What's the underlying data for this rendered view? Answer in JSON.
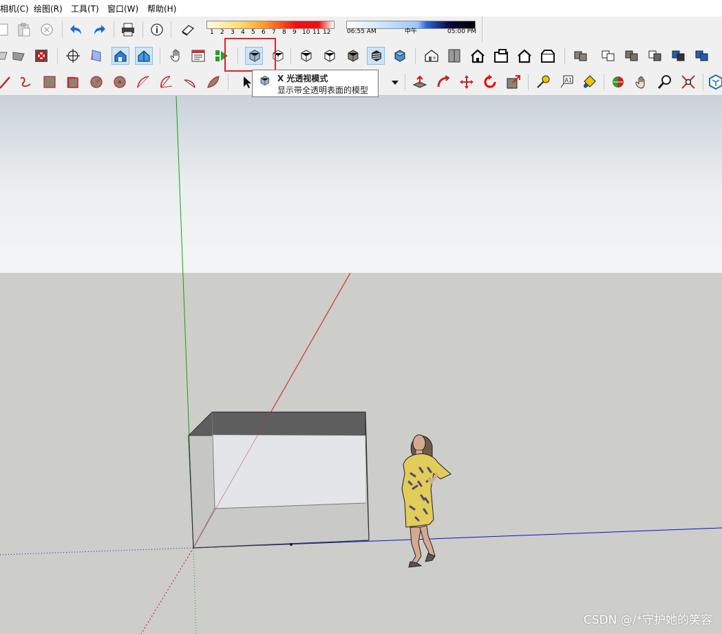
{
  "menu": {
    "items": [
      "相机(C)",
      "绘图(R)",
      "工具(T)",
      "窗口(W)",
      "帮助(H)"
    ]
  },
  "shadow_months": [
    "1",
    "2",
    "3",
    "4",
    "5",
    "6",
    "7",
    "8",
    "9",
    "10",
    "11",
    "12"
  ],
  "shadow_time": {
    "start": "06:55 AM",
    "noon": "中午",
    "end": "05:00 PM"
  },
  "tooltip": {
    "title": "X 光透视模式",
    "description": "显示带全透明表面的模型"
  },
  "watermark": "CSDN @/*守护她的笑容",
  "colors": {
    "accent": "#e02020",
    "x_axis": "#cc0000",
    "y_axis": "#00aa00",
    "z_axis": "#0000cc",
    "sky": "#f2f4f6",
    "ground": "#cdcdc9"
  },
  "toolbar_icons": {
    "row1": [
      "copy-icon",
      "paste-icon",
      "erase-icon",
      "undo-icon",
      "redo-icon",
      "print-icon",
      "model-info-icon",
      "shadows-icon"
    ],
    "row2": [
      "section-plane-icon",
      "section-display-icon",
      "section-cut-icon",
      "orbit-icon",
      "xray-box-icon",
      "house-view-icon",
      "house-view2-icon",
      "hand-icon",
      "scene-icon",
      "play-icon",
      "xray-mode-icon",
      "backface-icon",
      "wireframe-icon",
      "hidden-line-icon",
      "shaded-icon",
      "shaded-texture-icon",
      "monochrome-icon",
      "iso-view-icon",
      "top-view-icon",
      "front-view-icon",
      "right-view-icon",
      "back-view-icon",
      "left-view-icon",
      "component-icon",
      "outliner-icon",
      "layers-icon",
      "materials-icon",
      "styles-icon",
      "fog-icon"
    ],
    "row3": [
      "pencil-icon",
      "freehand-icon",
      "rectangle-icon",
      "rotated-rect-icon",
      "circle-icon",
      "polygon-icon",
      "arc-icon",
      "pie-icon",
      "three-point-arc-icon",
      "two-point-arc-icon",
      "select-icon",
      "dropdown-icon",
      "push-pull-icon",
      "follow-me-icon",
      "move-icon",
      "rotate-icon",
      "scale-icon",
      "tape-icon",
      "text-icon",
      "paint-icon",
      "walk-icon",
      "pan-icon",
      "zoom-icon",
      "zoom-extents-icon",
      "warehouse-icon"
    ]
  }
}
